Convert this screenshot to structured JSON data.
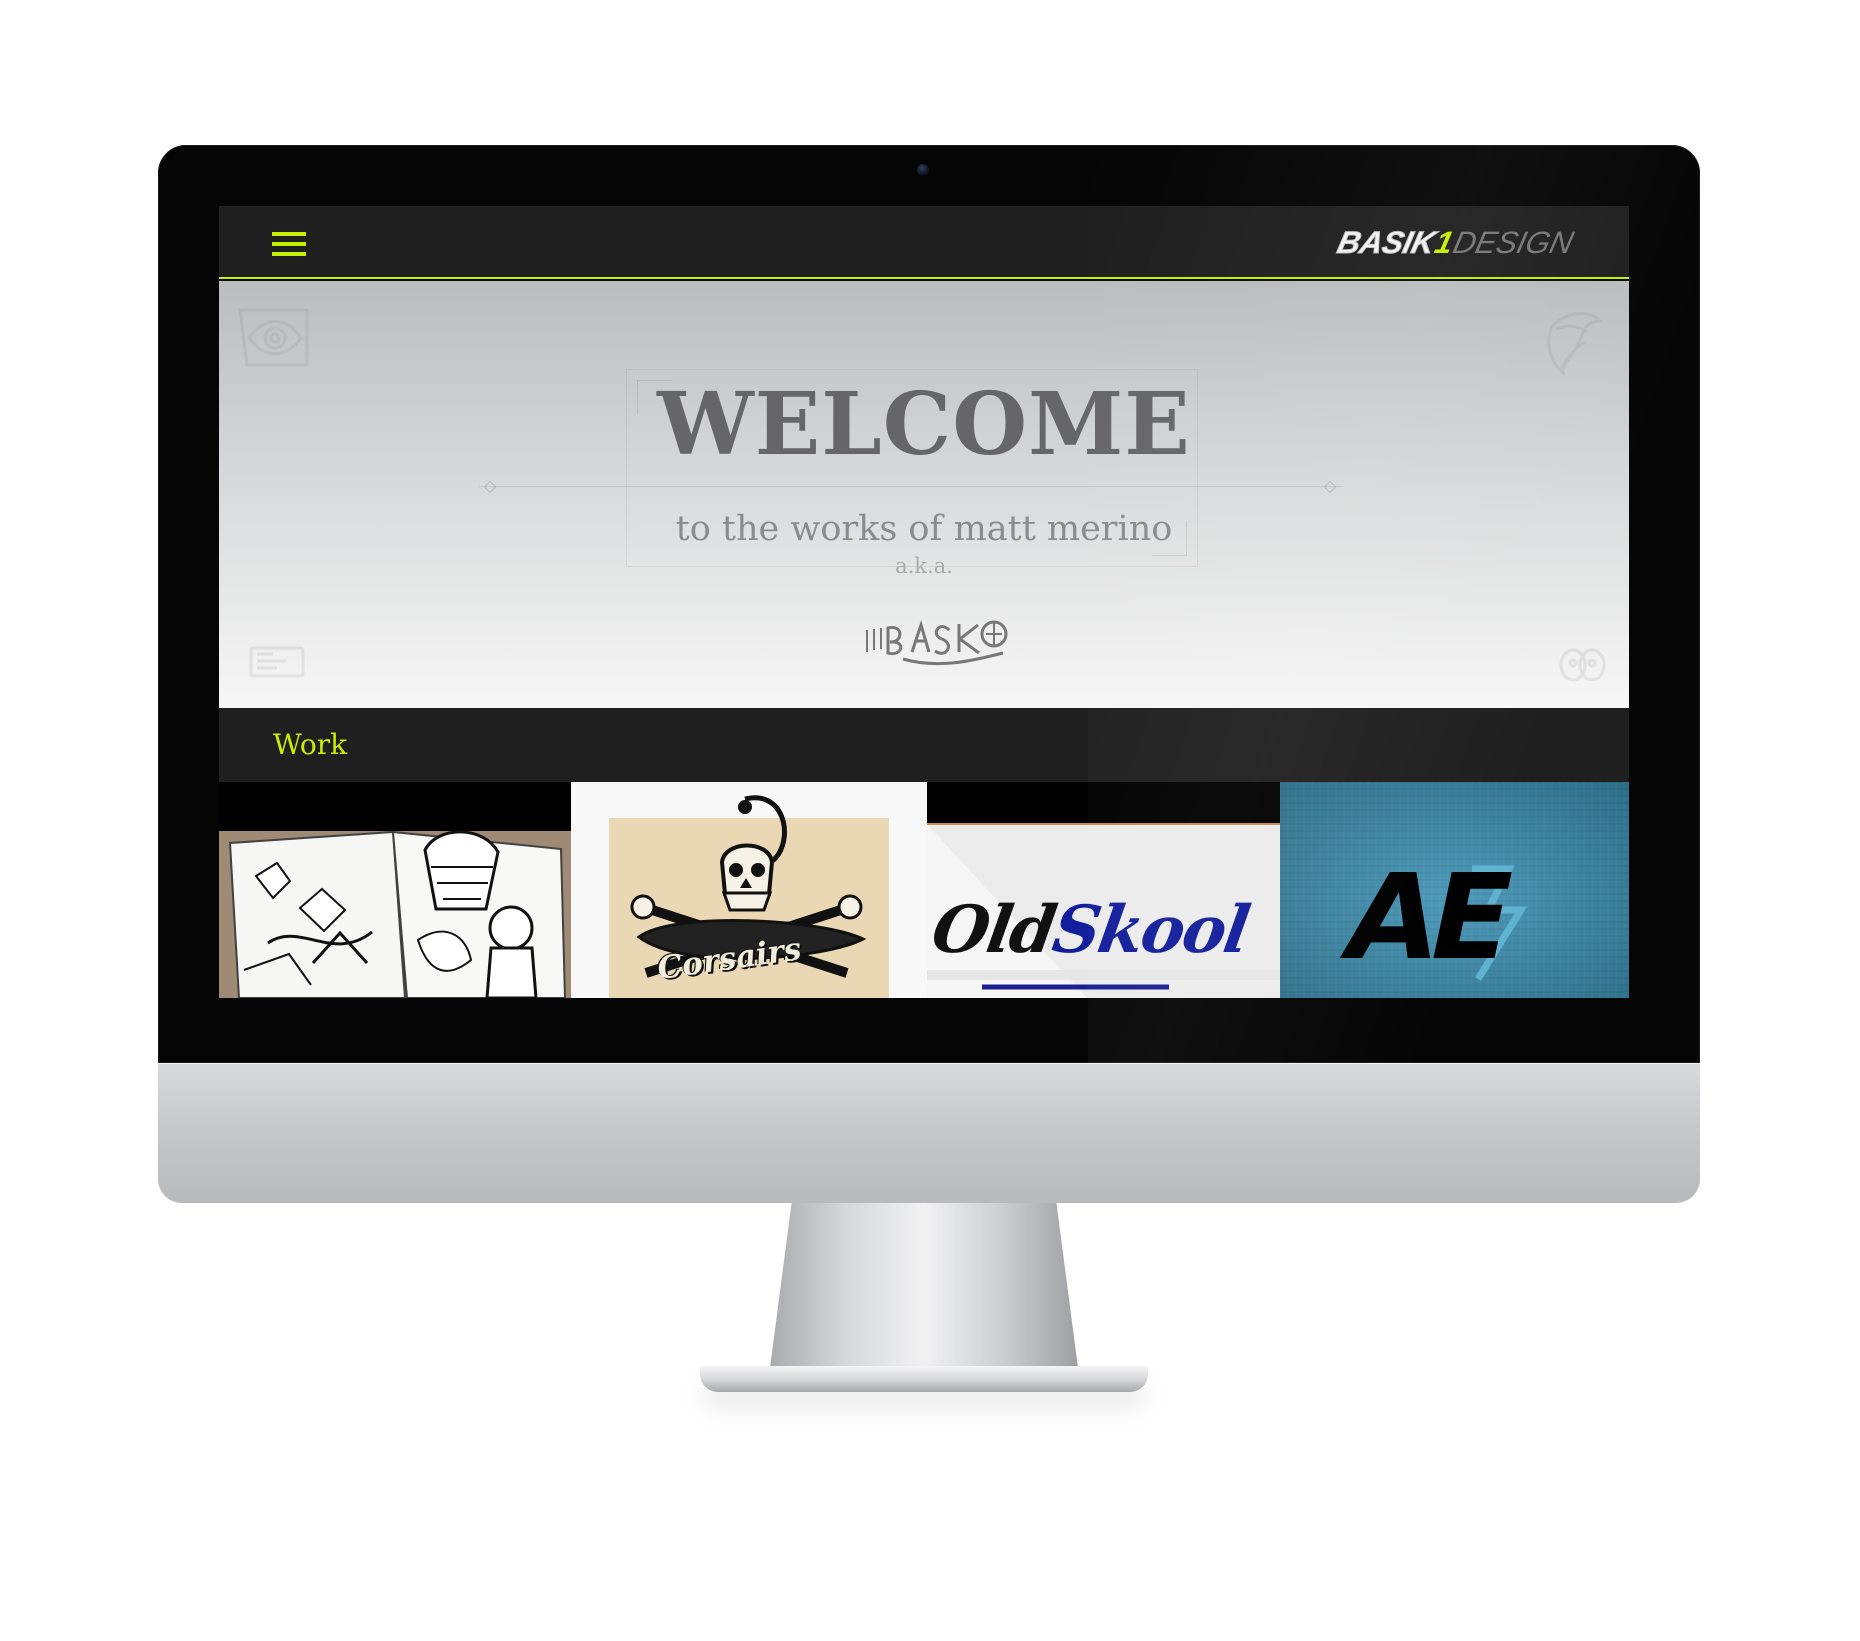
{
  "header": {
    "menu_icon": "hamburger-menu-icon",
    "brand_main": "BASIK",
    "brand_one": "1",
    "brand_sub": "DESIGN",
    "accent_color": "#c7f000"
  },
  "hero": {
    "title": "WELCOME",
    "subtitle": "to the works of matt merino",
    "aka": "a.k.a.",
    "signature_icon": "basik-signature-logo",
    "signature_text": "BASIK1"
  },
  "work": {
    "label": "Work",
    "items": [
      {
        "name": "coloring-book-work",
        "icon": "illustrated-book-thumbnail"
      },
      {
        "name": "corsairs-work",
        "title": "Corsairs",
        "icon": "skull-emblem-thumbnail"
      },
      {
        "name": "old-skool-work",
        "title_primary": "Old",
        "title_secondary": "Skool",
        "icon": "old-skool-logo-thumbnail"
      },
      {
        "name": "ae-work",
        "title": "AE",
        "icon": "ae-logo-thumbnail"
      }
    ]
  }
}
